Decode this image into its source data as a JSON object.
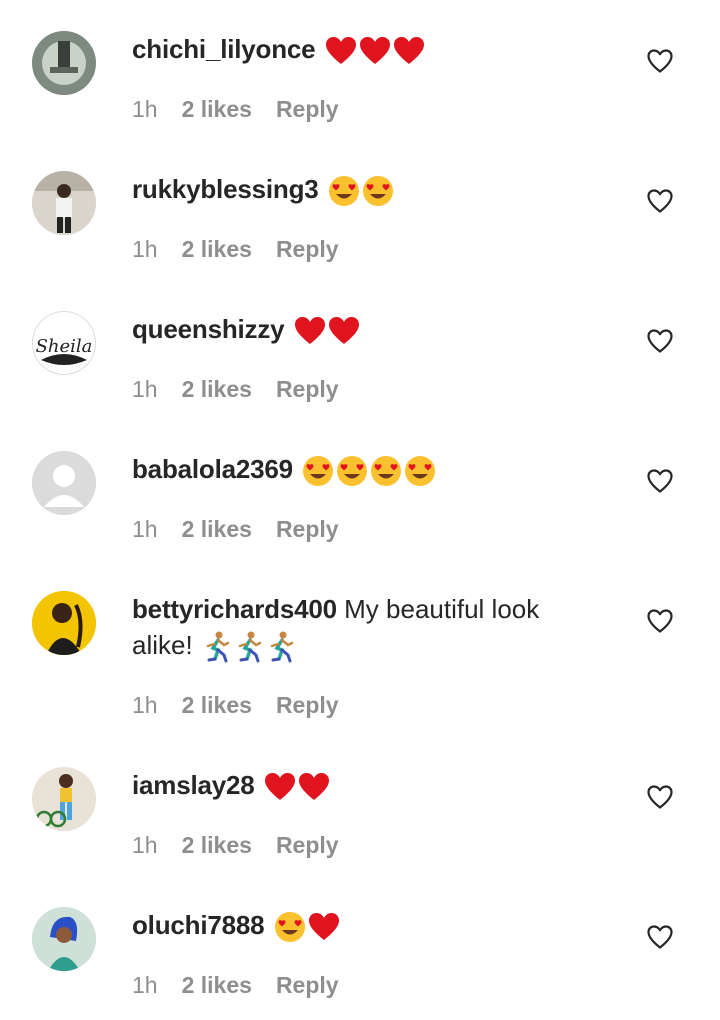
{
  "comments": [
    {
      "username": "chichi_lilyonce",
      "text": "",
      "emoji": [
        "heart",
        "heart",
        "heart"
      ],
      "time": "1h",
      "likes": "2 likes",
      "reply": "Reply"
    },
    {
      "username": "rukkyblessing3",
      "text": "",
      "emoji": [
        "heart-eyes",
        "heart-eyes"
      ],
      "time": "1h",
      "likes": "2 likes",
      "reply": "Reply"
    },
    {
      "username": "queenshizzy",
      "text": "",
      "emoji": [
        "heart",
        "heart"
      ],
      "time": "1h",
      "likes": "2 likes",
      "reply": "Reply",
      "avatar_text": "Sheila"
    },
    {
      "username": "babalola2369",
      "text": "",
      "emoji": [
        "heart-eyes",
        "heart-eyes",
        "heart-eyes",
        "heart-eyes"
      ],
      "time": "1h",
      "likes": "2 likes",
      "reply": "Reply"
    },
    {
      "username": "bettyrichards400",
      "text": "My beautiful look alike!",
      "emoji": [
        "runner",
        "runner",
        "runner"
      ],
      "time": "1h",
      "likes": "2 likes",
      "reply": "Reply"
    },
    {
      "username": "iamslay28",
      "text": "",
      "emoji": [
        "heart",
        "heart"
      ],
      "time": "1h",
      "likes": "2 likes",
      "reply": "Reply"
    },
    {
      "username": "oluchi7888",
      "text": "",
      "emoji": [
        "heart-eyes",
        "heart"
      ],
      "time": "1h",
      "likes": "2 likes",
      "reply": "Reply"
    }
  ],
  "colors": {
    "heart_red": "#e0141e",
    "meta_gray": "#8e8e8e",
    "emoji_yellow": "#fbc02d"
  }
}
